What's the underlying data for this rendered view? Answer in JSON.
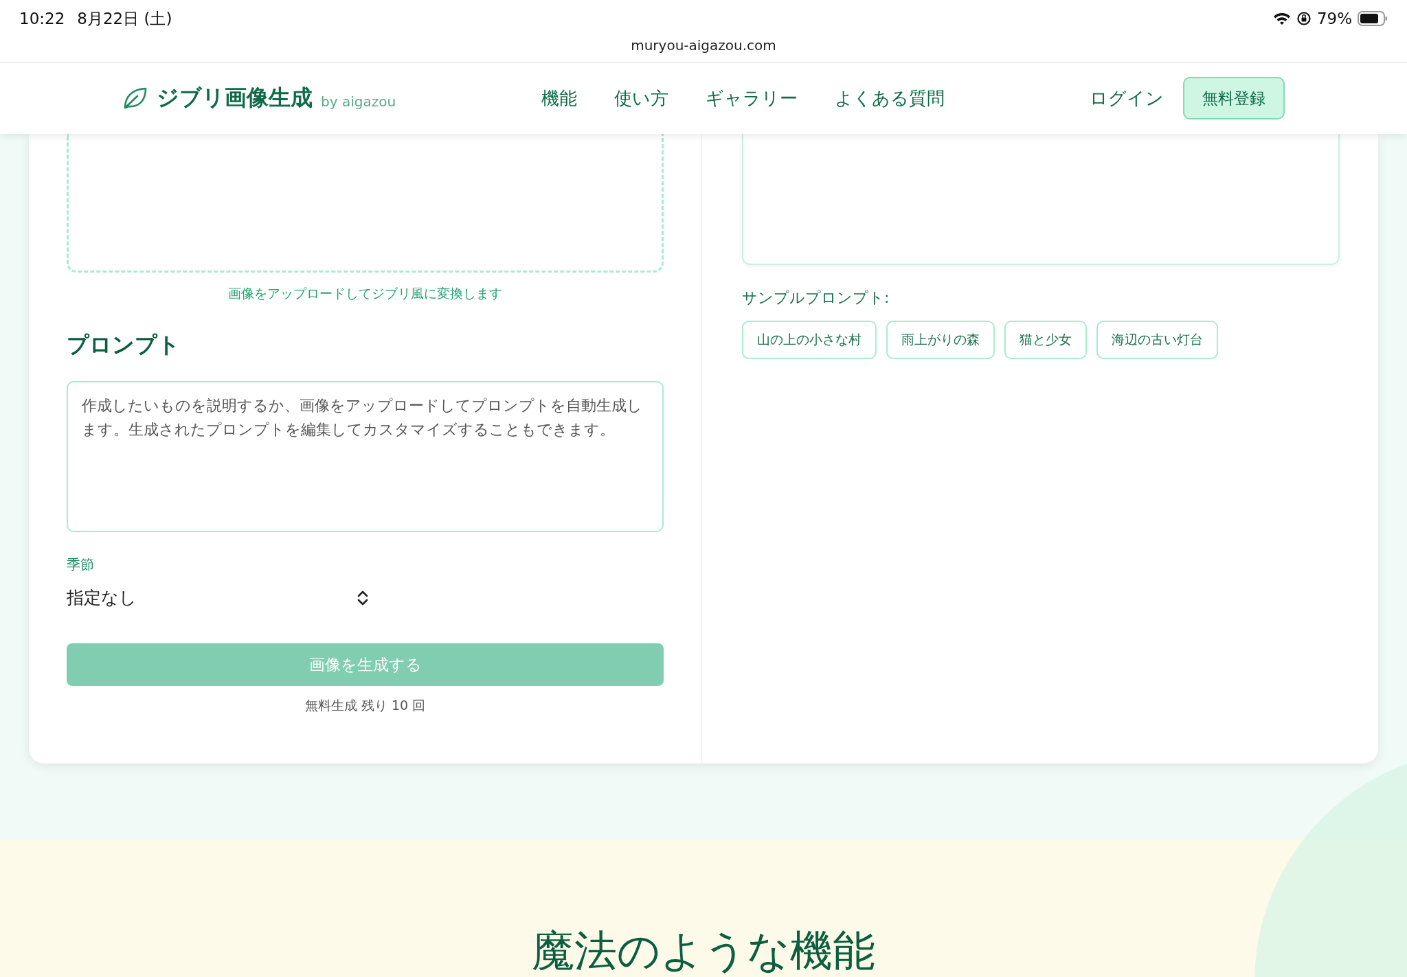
{
  "status_bar": {
    "time": "10:22",
    "date": "8月22日 (土)",
    "battery": "79%"
  },
  "address_bar": {
    "url": "muryou-aigazou.com"
  },
  "nav": {
    "logo": "ジブリ画像生成",
    "logo_suffix": "by aigazou",
    "links": [
      "機能",
      "使い方",
      "ギャラリー",
      "よくある質問"
    ],
    "login": "ログイン",
    "signup": "無料登録"
  },
  "upload": {
    "caption": "画像をアップロードしてジブリ風に変換します"
  },
  "prompt": {
    "heading": "プロンプト",
    "placeholder": "作成したいものを説明するか、画像をアップロードしてプロンプトを自動生成します。生成されたプロンプトを編集してカスタマイズすることもできます。",
    "season_label": "季節",
    "season_value": "指定なし",
    "generate_button": "画像を生成する",
    "generate_disabled": true,
    "remaining": "無料生成 残り 10 回"
  },
  "samples": {
    "label": "サンプルプロンプト:",
    "chips": [
      "山の上の小さな村",
      "雨上がりの森",
      "猫と少女",
      "海辺の古い灯台"
    ]
  },
  "features": {
    "heading": "魔法のような機能"
  }
}
